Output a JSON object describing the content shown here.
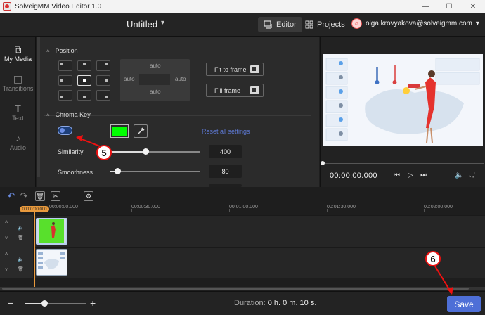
{
  "window": {
    "title": "SolveigMM Video Editor 1.0",
    "min": "—",
    "max": "☐",
    "close": "✕"
  },
  "header": {
    "project_title": "Untitled",
    "tabs": [
      {
        "label": "Editor"
      },
      {
        "label": "Projects"
      }
    ],
    "user_email": "olga.krovyakova@solveigmm.com"
  },
  "sidebar": {
    "items": [
      {
        "label": "My Media",
        "icon": "media-icon"
      },
      {
        "label": "Transitions",
        "icon": "transitions-icon"
      },
      {
        "label": "Text",
        "icon": "text-icon"
      },
      {
        "label": "Audio",
        "icon": "audio-icon"
      }
    ]
  },
  "position": {
    "heading": "Position",
    "auto_top": "auto",
    "auto_left": "auto",
    "auto_right": "auto",
    "auto_bottom": "auto",
    "fit_to_frame": "Fit to frame",
    "fill_frame": "Fill frame",
    "selected_anchor": "center"
  },
  "chroma": {
    "heading": "Chroma Key",
    "enabled": true,
    "key_color": "#00ff00",
    "reset_label": "Reset all settings",
    "similarity": {
      "label": "Similarity",
      "value": "400",
      "fraction": 0.39
    },
    "smoothness": {
      "label": "Smoothness",
      "value": "80",
      "fraction": 0.08
    }
  },
  "annotations": {
    "step5": "5",
    "step6": "6"
  },
  "preview": {
    "timecode": "00:00:00.000"
  },
  "timeline": {
    "playhead": "00:00:00.000",
    "ruler_labels": [
      "00:00:00.000",
      "00:00:30.000",
      "00:01:00.000",
      "00:01:30.000",
      "00:02:00.000"
    ]
  },
  "footer": {
    "zoom_fraction": 0.32,
    "duration_label": "Duration:",
    "duration_value": "0 h. 0 m. 10 s.",
    "save_label": "Save"
  },
  "colors": {
    "accent": "#4e6fd7",
    "playhead": "#e99a3d",
    "annotation": "#e11111"
  }
}
